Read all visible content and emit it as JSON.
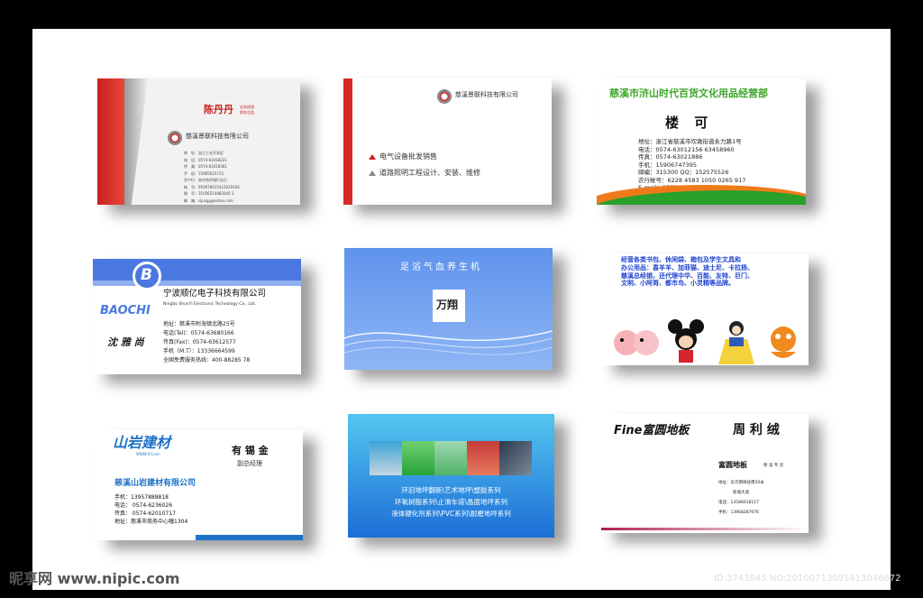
{
  "card1": {
    "name": "陈丹丹",
    "title_line1": "业务经理",
    "title_line2": "财务总监",
    "company": "慈溪景联科技有限公司",
    "lines": [
      "地　址：浙江工业开发区",
      "电　话：0574-63418221",
      "传　真：0574-63418361",
      "手　机：15965625715",
      "开户行：农村合作银行支行",
      "帐　号：95097801541202010S",
      "税　号：31056214482040 1",
      "邮　箱：sijusgg@sotvu.com"
    ]
  },
  "card2": {
    "company": "慈溪景联科技有限公司",
    "services": [
      "电气设备批发销售",
      "道路照明工程设计、安装、维修"
    ]
  },
  "card3": {
    "company": "慈溪市浒山时代百货文化用品经营部",
    "name": "楼 可",
    "lines": [
      "地址：浙江省慈溪市坎墩街道永力路1号",
      "电话：0574-63012156 63458960",
      "传真：0574-63021886",
      "手机：15906747395",
      "邮编：315300 QQ：152575526",
      "农行帐号：6228 4583 1050 0265 917",
      "E-mail：15577552 6@qq.com"
    ],
    "colors": {
      "red": "#d0231c",
      "green": "#3ea528",
      "orange": "#f07a1a"
    }
  },
  "card4": {
    "logo_letter": "B",
    "brand": "BAOCHI",
    "company": "宁波顺亿电子科技有限公司",
    "company_en": "Ningbo ShunYi Electronic Technology Co., Ltd.",
    "signature": "沈 雅 尚",
    "lines": [
      "地址：慈溪市附海镇北路25号",
      "电话(Tel)：0574-63680166",
      "传真(Fax)：0574-63612577",
      "手机（M.T）：13336664599",
      "全国免费服务热线：400-88285 78"
    ],
    "colors": {
      "blue": "#4b78e0"
    }
  },
  "card5": {
    "title": "足浴气血养生机",
    "brand": "万翔"
  },
  "card6": {
    "lines": [
      "经营各类书包、休闲袋、箱包及学生文具和",
      "办公用品：喜羊羊、加菲猫、迪士尼、卡拉扬、",
      "慈溪总经销，还代理中华、百能、友特、巨门、",
      "文明、小阿哥、都市鸟、小灵精等品牌。"
    ],
    "icons": [
      "pig-cartoon-icon",
      "mickey-cartoon-icon",
      "princess-cartoon-icon",
      "cat-cartoon-icon"
    ]
  },
  "card7": {
    "brand": "山岩建材",
    "website": "WWW.SY.com",
    "name": "有 锡 金",
    "title": "副总经理",
    "company": "慈溪山岩建材有限公司",
    "lines": [
      "手机：13957888818",
      "电话： 0574-6236026",
      "传真： 0574-62010717",
      "地址：慈溪市商务中心幢1304"
    ]
  },
  "card8": {
    "lines": [
      "环旧地坪翻新\\艺术地坪\\塑胶系列",
      "环氧树脂系列\\止滑车道\\晶面地坪系列",
      "液体硬化剂系列\\PVC系列\\耐磨地坪系列"
    ]
  },
  "card9": {
    "brand": "Fine富圆地板",
    "name": "周 利 绒",
    "sub_brand": "富圆地板",
    "sub_tag": "慈 溪 专 卖",
    "lines": [
      "地址：东方明珠往南50米",
      "新城大道",
      "电话：13586618117",
      "手机：13968287676"
    ]
  },
  "footer": {
    "watermark": "昵享网 www.nipic.com",
    "id": "ID:3743845 NO:20100713091413046672"
  }
}
